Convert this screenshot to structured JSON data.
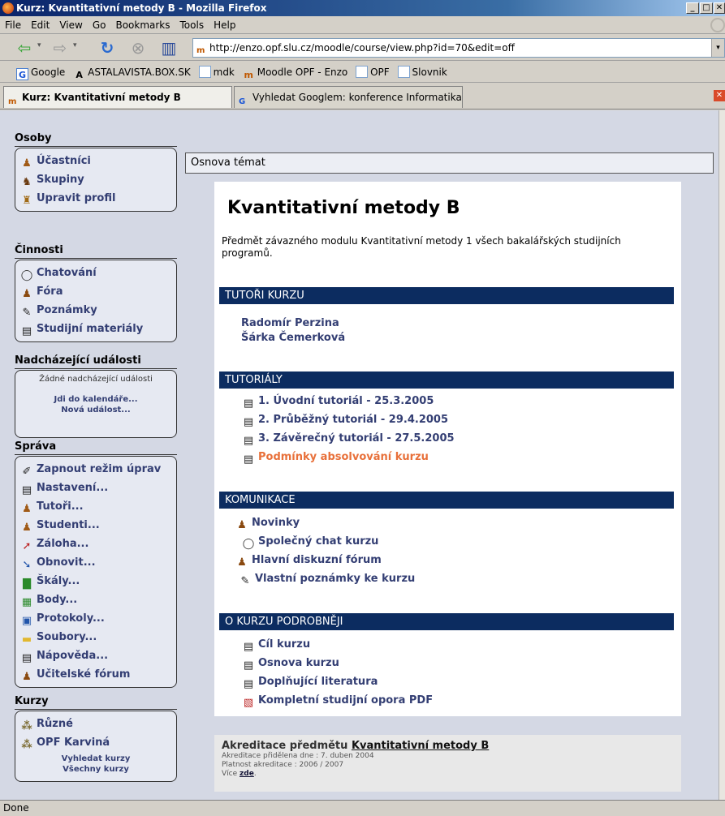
{
  "window": {
    "title": "Kurz: Kvantitativní metody B - Mozilla Firefox",
    "min": "_",
    "max": "□",
    "close": "✕"
  },
  "menu": [
    "File",
    "Edit",
    "View",
    "Go",
    "Bookmarks",
    "Tools",
    "Help"
  ],
  "url": "http://enzo.opf.slu.cz/moodle/course/view.php?id=70&edit=off",
  "bookmarks": [
    "Google",
    "ASTALAVISTA.BOX.SK",
    "mdk",
    "Moodle OPF - Enzo",
    "OPF",
    "Slovnik"
  ],
  "tabs": [
    "Kurz: Kvantitativní metody B",
    "Vyhledat Googlem: konference Informatika..."
  ],
  "status": "Done",
  "sidebar": {
    "osoby": {
      "title": "Osoby",
      "items": [
        "Účastníci",
        "Skupiny",
        "Upravit profil"
      ]
    },
    "cinnosti": {
      "title": "Činnosti",
      "items": [
        "Chatování",
        "Fóra",
        "Poznámky",
        "Studijní materiály"
      ]
    },
    "udalosti": {
      "title": "Nadcházející události",
      "none": "Žádné nadcházející události",
      "calendar": "Jdi do kalendáře...",
      "new_event": "Nová událost..."
    },
    "sprava": {
      "title": "Správa",
      "items": [
        "Zapnout režim úprav",
        "Nastavení...",
        "Tutoři...",
        "Studenti...",
        "Záloha...",
        "Obnovit...",
        "Škály...",
        "Body...",
        "Protokoly...",
        "Soubory...",
        "Nápověda...",
        "Učitelské fórum"
      ]
    },
    "kurzy": {
      "title": "Kurzy",
      "items": [
        "Různé",
        "OPF Karviná"
      ],
      "search": "Vyhledat kurzy",
      "all": "Všechny kurzy"
    }
  },
  "main": {
    "topics_title": "Osnova témat",
    "course_title": "Kvantitativní metody B",
    "description": "Předmět závazného modulu Kvantitativní metody 1 všech bakalářských studijních programů.",
    "sections": [
      {
        "title": "TUTOŘI KURZU",
        "items": [
          "Radomír Perzina",
          "Šárka Čemerková"
        ]
      },
      {
        "title": "TUTORIÁLY",
        "items": [
          "1. Úvodní tutoriál - 25.3.2005",
          "2. Průběžný tutoriál - 29.4.2005",
          "3. Závěrečný tutoriál - 27.5.2005",
          "Podmínky absolvování kurzu"
        ]
      },
      {
        "title": "KOMUNIKACE",
        "items": [
          "Novinky",
          "Společný chat kurzu",
          "Hlavní diskuzní fórum",
          "Vlastní poznámky ke kurzu"
        ]
      },
      {
        "title": "O KURZU PODROBNĚJI",
        "items": [
          "Cíl kurzu",
          "Osnova kurzu",
          "Doplňující literatura",
          "Kompletní studijní opora PDF"
        ]
      }
    ]
  },
  "accreditation": {
    "prefix": "Akreditace předmětu ",
    "course": "Kvantitativní metody B",
    "line1": "Akreditace přidělena dne : 7. duben 2004",
    "line2": "Platnost akreditace : 2006 / 2007",
    "more_prefix": "Více ",
    "more_link": "zde",
    "more_suffix": "."
  }
}
